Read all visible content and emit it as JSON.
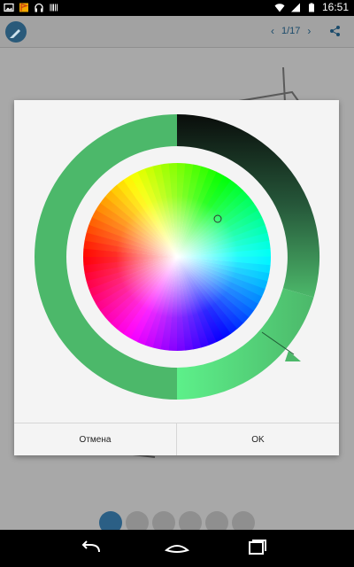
{
  "status_bar": {
    "time": "16:51",
    "left_icons": [
      "image-icon",
      "flag-icon",
      "headphones-icon",
      "barcode-icon"
    ],
    "right_icons": [
      "wifi-icon",
      "signal-icon",
      "battery-icon"
    ]
  },
  "action_bar": {
    "page_indicator": "1/17",
    "icons": [
      "app-logo-icon",
      "chevron-left-icon",
      "chevron-right-icon",
      "share-icon"
    ]
  },
  "bottom_tools": [
    "brush-icon",
    "eyedropper-icon",
    "eraser-icon",
    "sliders-icon",
    "refresh-icon",
    "download-icon"
  ],
  "dialog": {
    "cancel_label": "Отмена",
    "ok_label": "OK",
    "selected_color": "#4cb86a",
    "light_variant_color": "#5df08a",
    "dark_variant_color": "#0a0d0b"
  }
}
